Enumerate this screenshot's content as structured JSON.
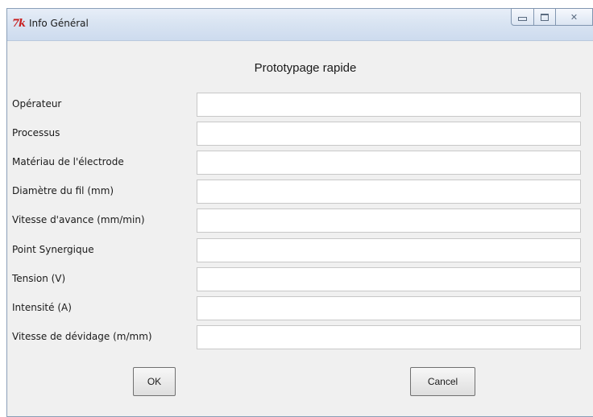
{
  "window": {
    "title": "Info Général",
    "app_icon": "7k",
    "minimize_icon": "minimize-icon",
    "maximize_icon": "maximize-icon",
    "close_glyph": "✕"
  },
  "form": {
    "heading": "Prototypage rapide",
    "fields": [
      {
        "label": "Opérateur",
        "value": ""
      },
      {
        "label": "Processus",
        "value": ""
      },
      {
        "label": "Matériau de l'électrode",
        "value": ""
      },
      {
        "label": "Diamètre du fil (mm)",
        "value": ""
      },
      {
        "label": "Vitesse d'avance (mm/min)",
        "value": ""
      },
      {
        "label": "Point Synergique",
        "value": ""
      },
      {
        "label": "Tension (V)",
        "value": ""
      },
      {
        "label": "Intensité (A)",
        "value": ""
      },
      {
        "label": "Vitesse de dévidage (m/mm)",
        "value": ""
      }
    ]
  },
  "buttons": {
    "ok": "OK",
    "cancel": "Cancel"
  }
}
